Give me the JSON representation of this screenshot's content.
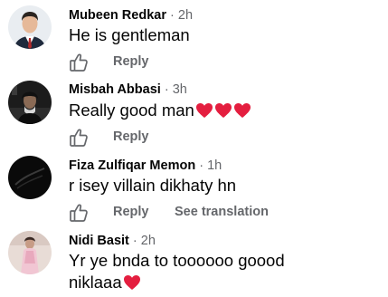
{
  "comments": [
    {
      "name": "Mubeen Redkar",
      "time": "2h",
      "text": "He is gentleman",
      "hearts": 0,
      "reply_label": "Reply",
      "see_translation": ""
    },
    {
      "name": "Misbah Abbasi",
      "time": "3h",
      "text": "Really good man",
      "hearts": 3,
      "reply_label": "Reply",
      "see_translation": ""
    },
    {
      "name": "Fiza Zulfiqar Memon",
      "time": "1h",
      "text": "r isey villain dikhaty hn",
      "hearts": 0,
      "reply_label": "Reply",
      "see_translation": "See translation"
    },
    {
      "name": "Nidi Basit",
      "time": "2h",
      "text_line1": "Yr ye bnda to toooooo goood",
      "text_line2": "niklaaa",
      "hearts": 1
    }
  ],
  "separator": "·",
  "colors": {
    "text": "#050505",
    "secondary": "#65676b",
    "heart": "#e41e3f"
  },
  "icons": {
    "like": "thumbs-up-outline-icon",
    "heart": "red-heart-emoji"
  }
}
